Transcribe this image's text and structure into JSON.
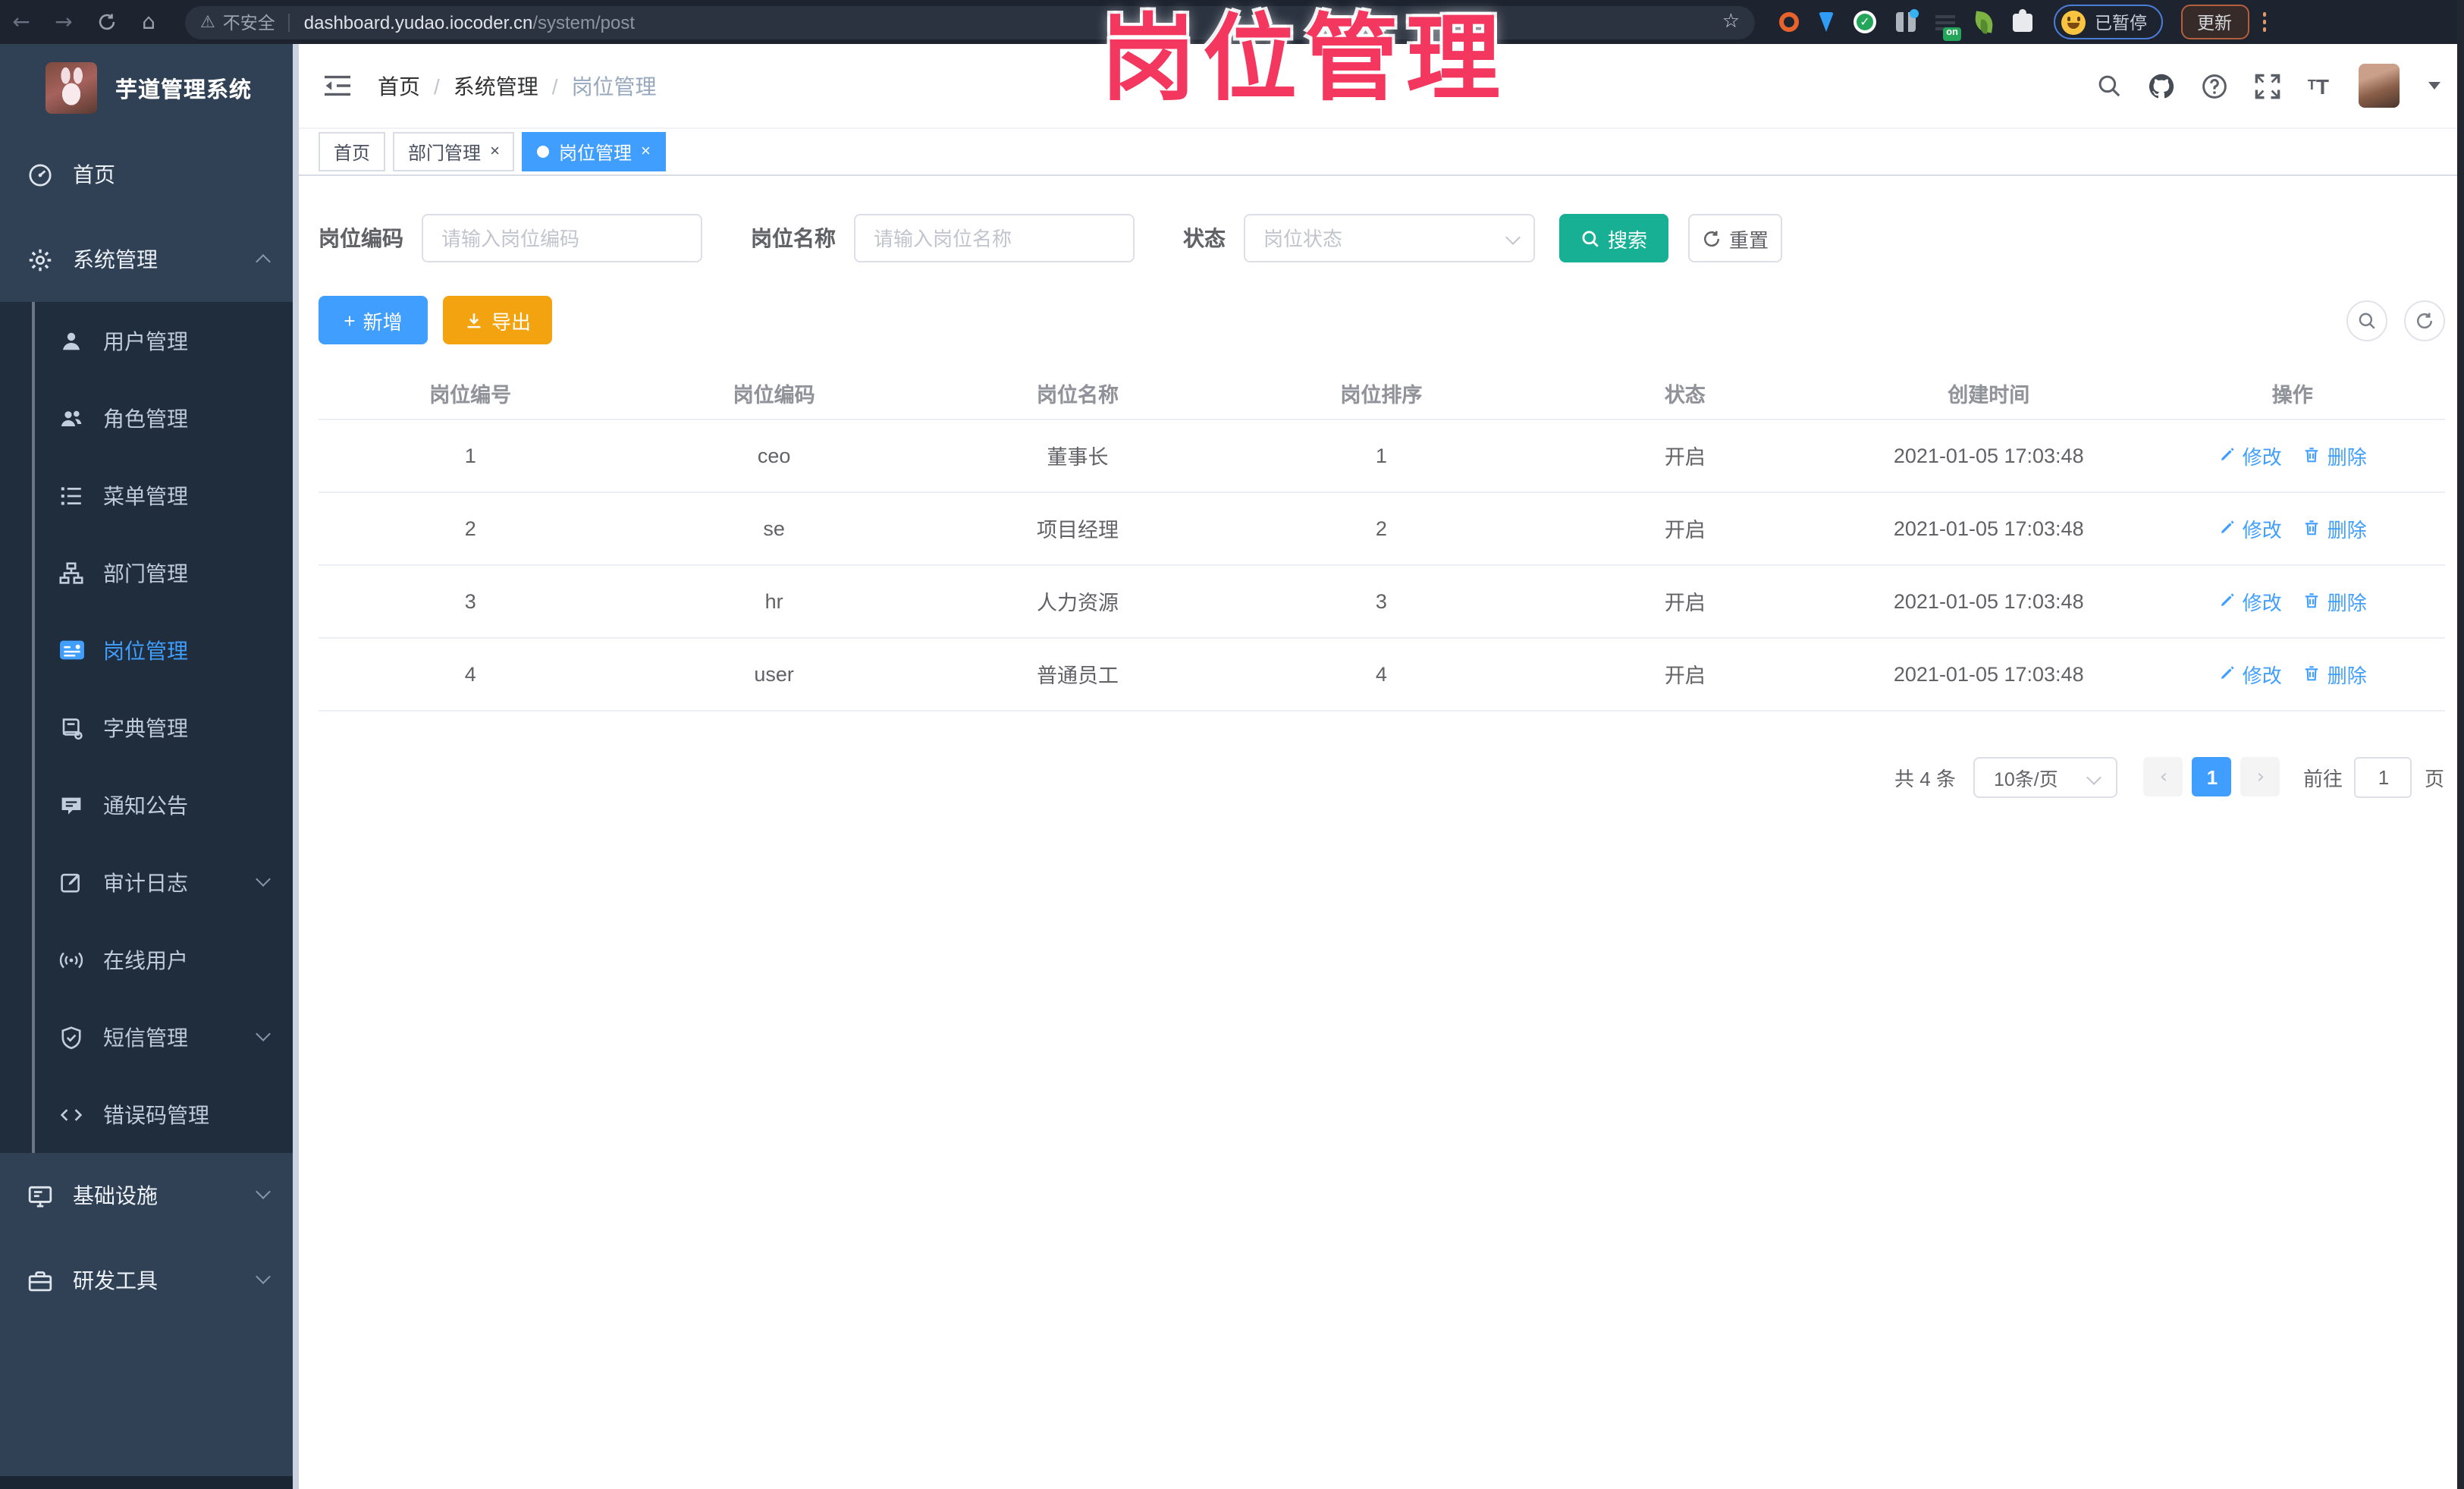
{
  "annotation": {
    "text": "岗位管理"
  },
  "browser": {
    "back_icon": "←",
    "forward_icon": "→",
    "home_icon": "⌂",
    "warning_icon": "⚠",
    "security_label": "不安全",
    "url_domain": "dashboard.yudao.iocoder.cn",
    "url_path": "/system/post",
    "star_icon": "☆",
    "on_badge": "on",
    "paused_label": "已暂停",
    "update_label": "更新"
  },
  "sidebar": {
    "logo_title": "芋道管理系统",
    "items": [
      {
        "label": "首页"
      },
      {
        "label": "系统管理"
      },
      {
        "label": "用户管理"
      },
      {
        "label": "角色管理"
      },
      {
        "label": "菜单管理"
      },
      {
        "label": "部门管理"
      },
      {
        "label": "岗位管理"
      },
      {
        "label": "字典管理"
      },
      {
        "label": "通知公告"
      },
      {
        "label": "审计日志"
      },
      {
        "label": "在线用户"
      },
      {
        "label": "短信管理"
      },
      {
        "label": "错误码管理"
      },
      {
        "label": "基础设施"
      },
      {
        "label": "研发工具"
      }
    ]
  },
  "header": {
    "breadcrumb": [
      "首页",
      "系统管理",
      "岗位管理"
    ],
    "separator": "/"
  },
  "ui": {
    "close": "×",
    "prev": "‹",
    "next": "›",
    "plus": "+"
  },
  "tabs": [
    {
      "label": "首页"
    },
    {
      "label": "部门管理"
    },
    {
      "label": "岗位管理"
    }
  ],
  "filters": {
    "post_code": {
      "label": "岗位编码",
      "placeholder": "请输入岗位编码"
    },
    "post_name": {
      "label": "岗位名称",
      "placeholder": "请输入岗位名称"
    },
    "status": {
      "label": "状态",
      "placeholder": "岗位状态"
    },
    "search_label": "搜索",
    "reset_label": "重置"
  },
  "toolbar": {
    "add_label": "新增",
    "export_label": "导出"
  },
  "table": {
    "columns": [
      "岗位编号",
      "岗位编码",
      "岗位名称",
      "岗位排序",
      "状态",
      "创建时间",
      "操作"
    ],
    "edit_label": "修改",
    "delete_label": "删除",
    "rows": [
      {
        "id": "1",
        "code": "ceo",
        "name": "董事长",
        "sort": "1",
        "status": "开启",
        "created": "2021-01-05 17:03:48"
      },
      {
        "id": "2",
        "code": "se",
        "name": "项目经理",
        "sort": "2",
        "status": "开启",
        "created": "2021-01-05 17:03:48"
      },
      {
        "id": "3",
        "code": "hr",
        "name": "人力资源",
        "sort": "3",
        "status": "开启",
        "created": "2021-01-05 17:03:48"
      },
      {
        "id": "4",
        "code": "user",
        "name": "普通员工",
        "sort": "4",
        "status": "开启",
        "created": "2021-01-05 17:03:48"
      }
    ]
  },
  "pagination": {
    "total_text": "共 4 条",
    "page_size": "10条/页",
    "current_page": "1",
    "goto_label": "前往",
    "goto_value": "1",
    "page_unit": "页"
  },
  "colors": {
    "primary": "#409eff",
    "search_teal": "#17b095",
    "export_amber": "#f2a30f",
    "sidebar_bg": "#304156",
    "submenu_bg": "#1f2d3d",
    "annotation_pink": "#f4375f",
    "link": "#409eff"
  }
}
